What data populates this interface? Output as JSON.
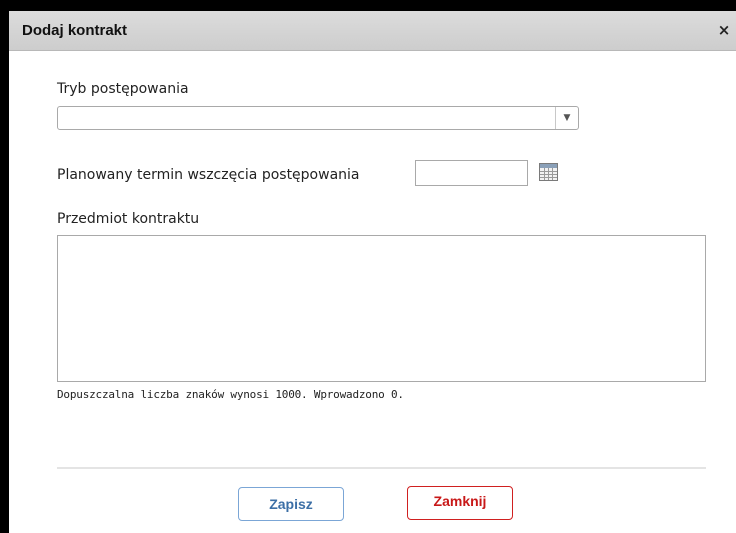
{
  "dialog": {
    "title": "Dodaj kontrakt",
    "close_glyph": "×"
  },
  "form": {
    "mode_label": "Tryb postępowania",
    "mode_value": "",
    "date_label": "Planowany termin wszczęcia postępowania",
    "date_value": "",
    "subject_label": "Przedmiot kontraktu",
    "subject_value": "",
    "char_hint": "Dopuszczalna liczba znaków wynosi 1000. Wprowadzono 0."
  },
  "buttons": {
    "save_label": "Zapisz",
    "close_label": "Zamknij"
  },
  "icons": {
    "dropdown": "chevron-down-icon",
    "calendar": "calendar-icon"
  },
  "colors": {
    "save_border": "#7ba6d6",
    "save_text": "#3c6fa6",
    "close_border": "#d02020",
    "close_text": "#c81818"
  }
}
